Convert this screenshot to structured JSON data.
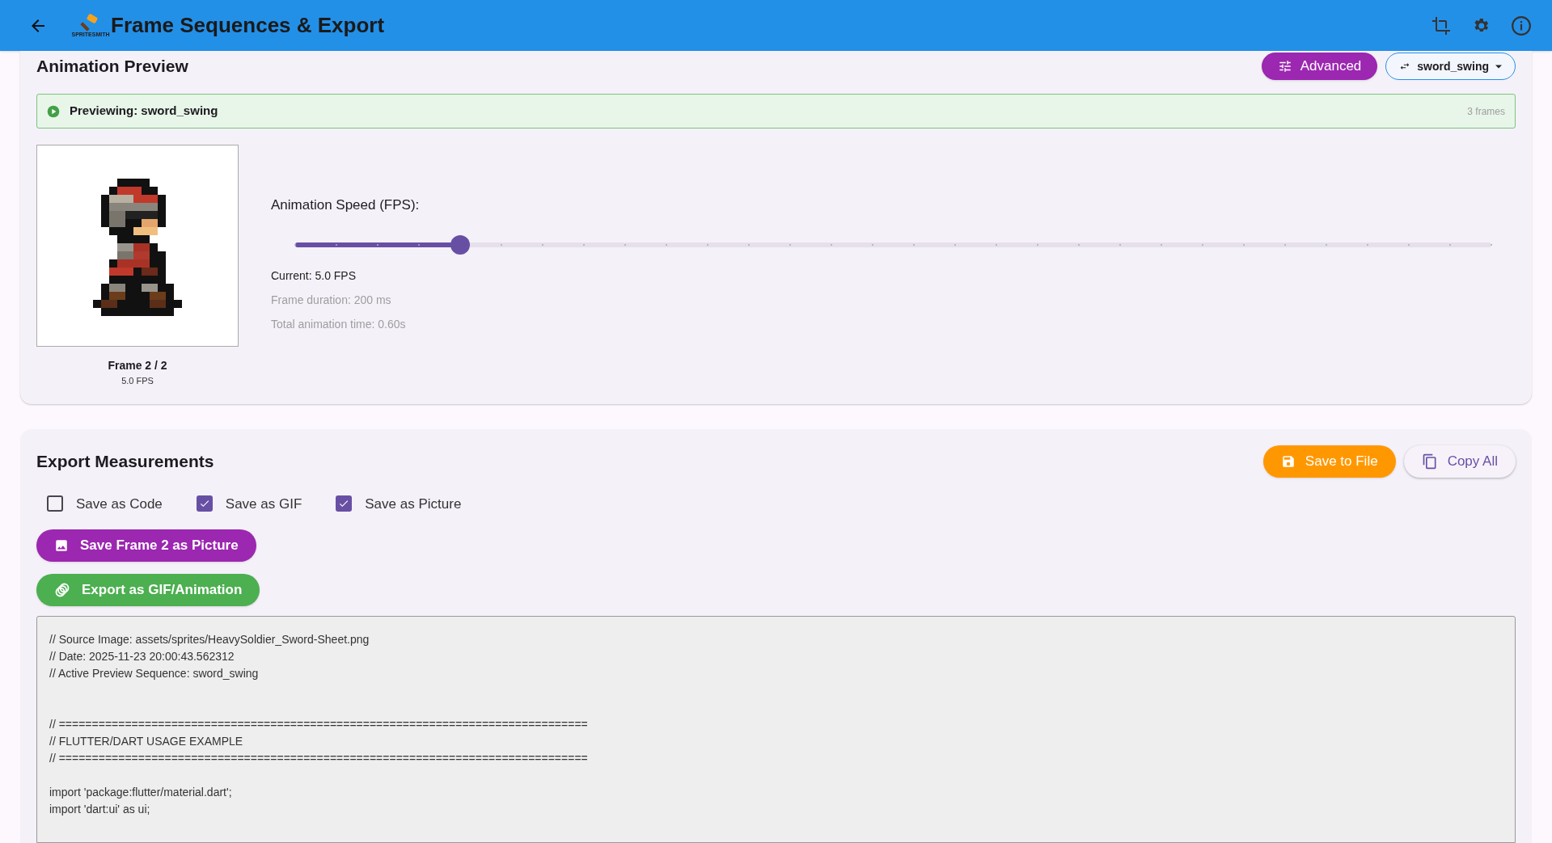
{
  "app_bar": {
    "title": "Frame Sequences & Export",
    "logo_text": "SPRITESMITH"
  },
  "preview": {
    "title": "Animation Preview",
    "advanced_button": "Advanced",
    "sequence": "sword_swing",
    "status": {
      "text": "Previewing: sword_swing",
      "frames": "3 frames"
    },
    "frame_label": "Frame 2 / 2",
    "frame_fps": "5.0 FPS",
    "speed_label": "Animation Speed (FPS):",
    "speed": {
      "level": 0.138
    },
    "stats": [
      {
        "kind": "primary",
        "text": "Current: 5.0 FPS"
      },
      {
        "kind": "secondary",
        "text": "Frame duration: 200 ms"
      },
      {
        "kind": "secondary",
        "text": "Total animation time: 0.60s"
      }
    ]
  },
  "export": {
    "title": "Export Measurements",
    "actions": [
      {
        "kind": "filled",
        "label": "Save to File"
      },
      {
        "kind": "outlined",
        "label": "Copy All"
      }
    ],
    "options": [
      {
        "label": "Save as Code",
        "checked": false
      },
      {
        "label": "Save as GIF",
        "checked": true
      },
      {
        "label": "Save as Picture",
        "checked": true
      }
    ],
    "buttons": [
      {
        "kind": "picture",
        "label": "Save Frame 2 as Picture",
        "color": "#9c27b0"
      },
      {
        "kind": "gif",
        "label": "Export as GIF/Animation",
        "color": "#4caf50"
      }
    ],
    "code": "// Source Image: assets/sprites/HeavySoldier_Sword-Sheet.png\n// Date: 2025-11-23 20:00:43.562312\n// Active Preview Sequence: sword_swing\n\n\n// ================================================================================\n// FLUTTER/DART USAGE EXAMPLE\n// ================================================================================\n\nimport 'package:flutter/material.dart';\nimport 'dart:ui' as ui;"
  }
}
